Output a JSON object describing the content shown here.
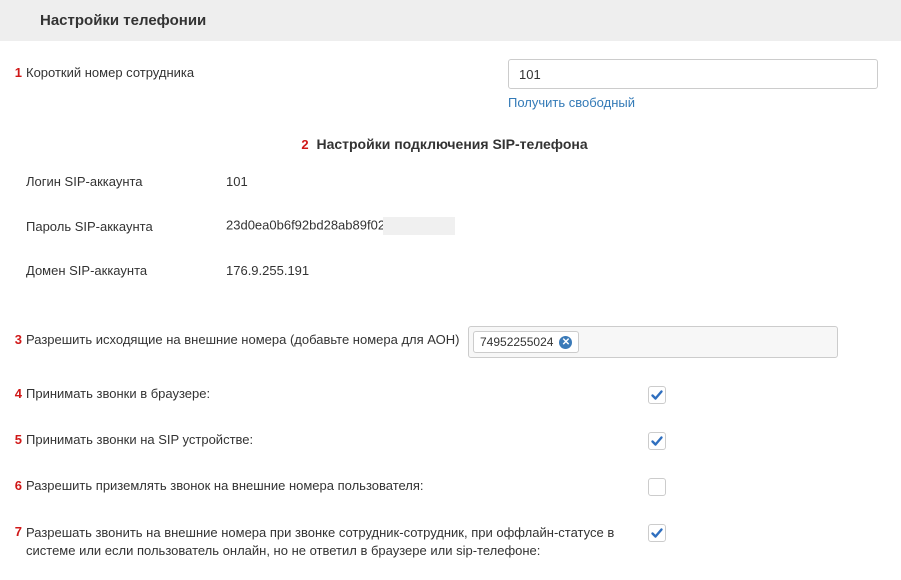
{
  "header": {
    "title": "Настройки телефонии"
  },
  "shortNumber": {
    "num": "1",
    "label": "Короткий номер сотрудника",
    "value": "101",
    "getFreeLink": "Получить свободный"
  },
  "sipSection": {
    "num": "2",
    "title": "Настройки подключения SIP-телефона",
    "loginLabel": "Логин SIP-аккаунта",
    "loginValue": "101",
    "passwordLabel": "Пароль SIP-аккаунта",
    "passwordValue": "23d0ea0b6f92bd28ab89f02",
    "domainLabel": "Домен SIP-аккаунта",
    "domainValue": "176.9.255.191"
  },
  "callerId": {
    "num": "3",
    "label": "Разрешить исходящие на внешние номера (добавьте номера для АОН)",
    "tokens": [
      "74952255024"
    ]
  },
  "options": [
    {
      "num": "4",
      "label": "Принимать звонки в браузере:",
      "checked": true
    },
    {
      "num": "5",
      "label": "Принимать звонки на SIP устройстве:",
      "checked": true
    },
    {
      "num": "6",
      "label": "Разрешить приземлять звонок на внешние номера пользователя:",
      "checked": false
    },
    {
      "num": "7",
      "label": "Разрешать звонить на внешние номера при звонке сотрудник-сотрудник, при оффлайн-статусе в системе или если пользователь онлайн, но не ответил в браузере или sip-телефоне:",
      "checked": true
    }
  ]
}
